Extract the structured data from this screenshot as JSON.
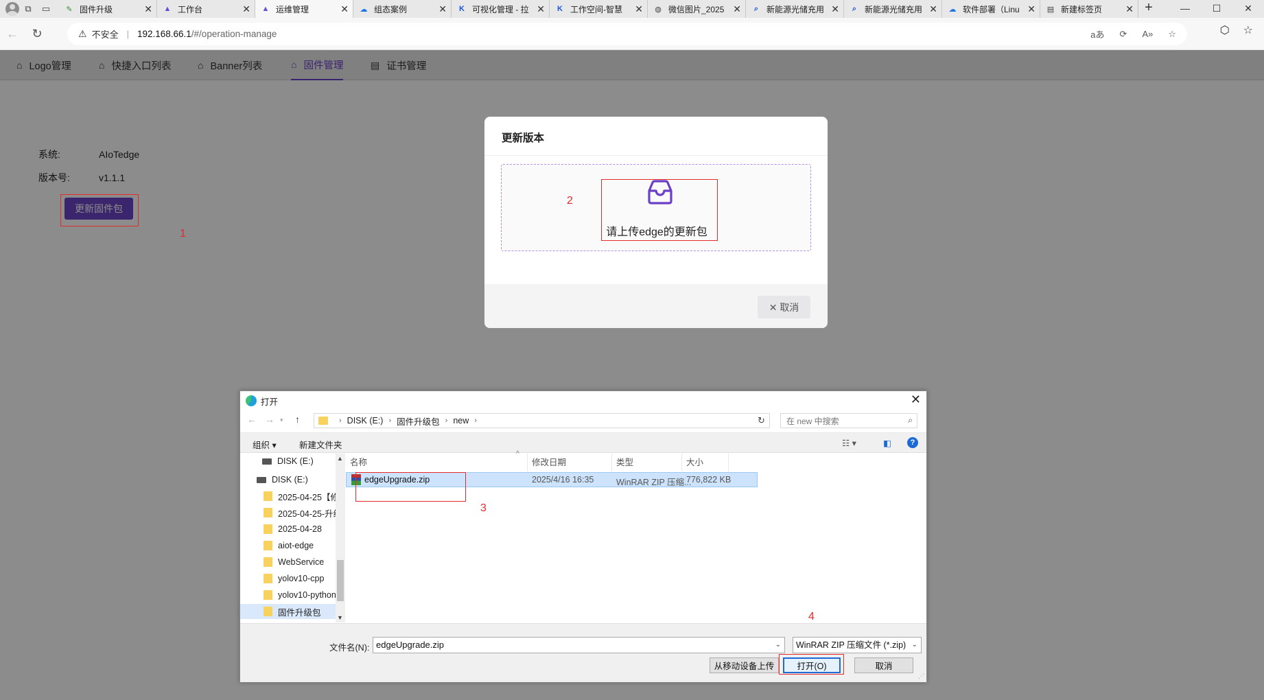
{
  "browser": {
    "tabs": [
      {
        "label": "固件升级",
        "icon": "doc-edit-icon",
        "color": "#3c8f3c"
      },
      {
        "label": "工作台",
        "icon": "triangle-logo-icon",
        "color": "#6b4cd6"
      },
      {
        "label": "运维管理",
        "icon": "triangle-logo-icon",
        "color": "#6b4cd6",
        "active": true
      },
      {
        "label": "组态案例",
        "icon": "cloud-icon",
        "color": "#1a73e8"
      },
      {
        "label": "可视化管理 - 拉",
        "icon": "tk-logo-icon",
        "color": "#1a56db"
      },
      {
        "label": "工作空间-智慧",
        "icon": "tk-logo-icon",
        "color": "#1a56db"
      },
      {
        "label": "微信图片_2025",
        "icon": "globe-icon",
        "color": "#444444"
      },
      {
        "label": "新能源光储充用",
        "icon": "search-icon",
        "color": "#1a56db"
      },
      {
        "label": "新能源光储充用",
        "icon": "search-icon",
        "color": "#1a56db"
      },
      {
        "label": "软件部署（Linu",
        "icon": "cloud-icon",
        "color": "#1a73e8"
      },
      {
        "label": "新建标签页",
        "icon": "newtab-icon",
        "color": "#444444"
      }
    ],
    "address": {
      "security_label": "不安全",
      "host": "192.168.66.1",
      "path": "/#/operation-manage"
    }
  },
  "app_nav": {
    "items": [
      {
        "label": "Logo管理",
        "icon": "home-icon"
      },
      {
        "label": "快捷入口列表",
        "icon": "home-icon"
      },
      {
        "label": "Banner列表",
        "icon": "home-icon"
      },
      {
        "label": "固件管理",
        "icon": "home-icon",
        "active": true
      },
      {
        "label": "证书管理",
        "icon": "certificate-icon"
      }
    ],
    "accent_color": "#6b3fc8"
  },
  "firmware": {
    "system_label": "系统:",
    "system_value": "AIoTedge",
    "version_label": "版本号:",
    "version_value": "v1.1.1",
    "update_button": "更新固件包"
  },
  "modal": {
    "title": "更新版本",
    "upload_hint": "请上传edge的更新包",
    "cancel_button": "取消"
  },
  "annotations": [
    "1",
    "2",
    "3",
    "4"
  ],
  "file_dialog": {
    "title": "打开",
    "path": [
      "DISK (E:)",
      "固件升级包",
      "new"
    ],
    "search_placeholder": "在 new 中搜索",
    "toolbar": {
      "organize": "组织 ▾",
      "new_folder": "新建文件夹"
    },
    "nav_items": [
      {
        "label": "DISK (E:)",
        "type": "drive"
      },
      {
        "label": "DISK (E:)",
        "type": "drive"
      },
      {
        "label": "2025-04-25【修",
        "type": "folder"
      },
      {
        "label": "2025-04-25-升级",
        "type": "folder"
      },
      {
        "label": "2025-04-28",
        "type": "folder"
      },
      {
        "label": "aiot-edge",
        "type": "folder"
      },
      {
        "label": "WebService",
        "type": "folder"
      },
      {
        "label": "yolov10-cpp",
        "type": "folder"
      },
      {
        "label": "yolov10-python",
        "type": "folder"
      },
      {
        "label": "固件升级包",
        "type": "folder",
        "selected": true
      }
    ],
    "columns": [
      "名称",
      "修改日期",
      "类型",
      "大小"
    ],
    "files": [
      {
        "name": "edgeUpgrade.zip",
        "modified": "2025/4/16 16:35",
        "type": "WinRAR ZIP 压缩...",
        "size": "776,822 KB"
      }
    ],
    "filename_label": "文件名(N):",
    "filename_value": "edgeUpgrade.zip",
    "filetype_value": "WinRAR ZIP 压缩文件 (*.zip)",
    "buttons": {
      "upload_mobile": "从移动设备上传",
      "open": "打开(O)",
      "cancel": "取消"
    }
  }
}
